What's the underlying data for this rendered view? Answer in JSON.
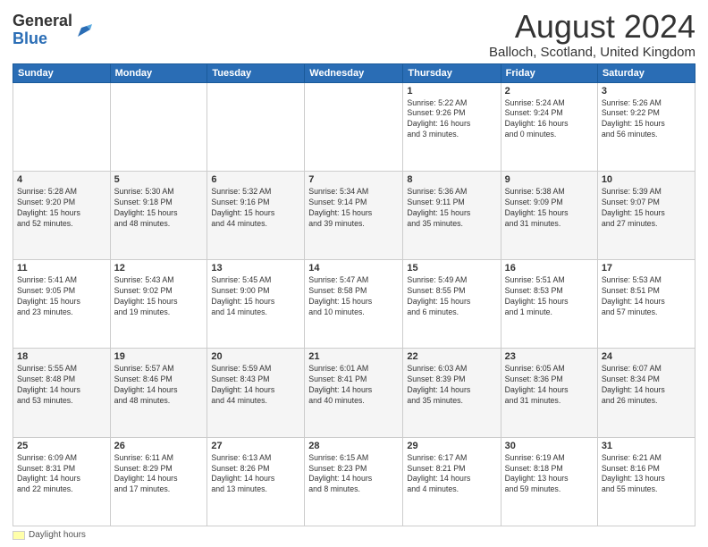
{
  "header": {
    "logo_general": "General",
    "logo_blue": "Blue",
    "title": "August 2024",
    "subtitle": "Balloch, Scotland, United Kingdom"
  },
  "days_of_week": [
    "Sunday",
    "Monday",
    "Tuesday",
    "Wednesday",
    "Thursday",
    "Friday",
    "Saturday"
  ],
  "footer": {
    "swatch_label": "Daylight hours"
  },
  "weeks": [
    [
      {
        "day": "",
        "detail": ""
      },
      {
        "day": "",
        "detail": ""
      },
      {
        "day": "",
        "detail": ""
      },
      {
        "day": "",
        "detail": ""
      },
      {
        "day": "1",
        "detail": "Sunrise: 5:22 AM\nSunset: 9:26 PM\nDaylight: 16 hours\nand 3 minutes."
      },
      {
        "day": "2",
        "detail": "Sunrise: 5:24 AM\nSunset: 9:24 PM\nDaylight: 16 hours\nand 0 minutes."
      },
      {
        "day": "3",
        "detail": "Sunrise: 5:26 AM\nSunset: 9:22 PM\nDaylight: 15 hours\nand 56 minutes."
      }
    ],
    [
      {
        "day": "4",
        "detail": "Sunrise: 5:28 AM\nSunset: 9:20 PM\nDaylight: 15 hours\nand 52 minutes."
      },
      {
        "day": "5",
        "detail": "Sunrise: 5:30 AM\nSunset: 9:18 PM\nDaylight: 15 hours\nand 48 minutes."
      },
      {
        "day": "6",
        "detail": "Sunrise: 5:32 AM\nSunset: 9:16 PM\nDaylight: 15 hours\nand 44 minutes."
      },
      {
        "day": "7",
        "detail": "Sunrise: 5:34 AM\nSunset: 9:14 PM\nDaylight: 15 hours\nand 39 minutes."
      },
      {
        "day": "8",
        "detail": "Sunrise: 5:36 AM\nSunset: 9:11 PM\nDaylight: 15 hours\nand 35 minutes."
      },
      {
        "day": "9",
        "detail": "Sunrise: 5:38 AM\nSunset: 9:09 PM\nDaylight: 15 hours\nand 31 minutes."
      },
      {
        "day": "10",
        "detail": "Sunrise: 5:39 AM\nSunset: 9:07 PM\nDaylight: 15 hours\nand 27 minutes."
      }
    ],
    [
      {
        "day": "11",
        "detail": "Sunrise: 5:41 AM\nSunset: 9:05 PM\nDaylight: 15 hours\nand 23 minutes."
      },
      {
        "day": "12",
        "detail": "Sunrise: 5:43 AM\nSunset: 9:02 PM\nDaylight: 15 hours\nand 19 minutes."
      },
      {
        "day": "13",
        "detail": "Sunrise: 5:45 AM\nSunset: 9:00 PM\nDaylight: 15 hours\nand 14 minutes."
      },
      {
        "day": "14",
        "detail": "Sunrise: 5:47 AM\nSunset: 8:58 PM\nDaylight: 15 hours\nand 10 minutes."
      },
      {
        "day": "15",
        "detail": "Sunrise: 5:49 AM\nSunset: 8:55 PM\nDaylight: 15 hours\nand 6 minutes."
      },
      {
        "day": "16",
        "detail": "Sunrise: 5:51 AM\nSunset: 8:53 PM\nDaylight: 15 hours\nand 1 minute."
      },
      {
        "day": "17",
        "detail": "Sunrise: 5:53 AM\nSunset: 8:51 PM\nDaylight: 14 hours\nand 57 minutes."
      }
    ],
    [
      {
        "day": "18",
        "detail": "Sunrise: 5:55 AM\nSunset: 8:48 PM\nDaylight: 14 hours\nand 53 minutes."
      },
      {
        "day": "19",
        "detail": "Sunrise: 5:57 AM\nSunset: 8:46 PM\nDaylight: 14 hours\nand 48 minutes."
      },
      {
        "day": "20",
        "detail": "Sunrise: 5:59 AM\nSunset: 8:43 PM\nDaylight: 14 hours\nand 44 minutes."
      },
      {
        "day": "21",
        "detail": "Sunrise: 6:01 AM\nSunset: 8:41 PM\nDaylight: 14 hours\nand 40 minutes."
      },
      {
        "day": "22",
        "detail": "Sunrise: 6:03 AM\nSunset: 8:39 PM\nDaylight: 14 hours\nand 35 minutes."
      },
      {
        "day": "23",
        "detail": "Sunrise: 6:05 AM\nSunset: 8:36 PM\nDaylight: 14 hours\nand 31 minutes."
      },
      {
        "day": "24",
        "detail": "Sunrise: 6:07 AM\nSunset: 8:34 PM\nDaylight: 14 hours\nand 26 minutes."
      }
    ],
    [
      {
        "day": "25",
        "detail": "Sunrise: 6:09 AM\nSunset: 8:31 PM\nDaylight: 14 hours\nand 22 minutes."
      },
      {
        "day": "26",
        "detail": "Sunrise: 6:11 AM\nSunset: 8:29 PM\nDaylight: 14 hours\nand 17 minutes."
      },
      {
        "day": "27",
        "detail": "Sunrise: 6:13 AM\nSunset: 8:26 PM\nDaylight: 14 hours\nand 13 minutes."
      },
      {
        "day": "28",
        "detail": "Sunrise: 6:15 AM\nSunset: 8:23 PM\nDaylight: 14 hours\nand 8 minutes."
      },
      {
        "day": "29",
        "detail": "Sunrise: 6:17 AM\nSunset: 8:21 PM\nDaylight: 14 hours\nand 4 minutes."
      },
      {
        "day": "30",
        "detail": "Sunrise: 6:19 AM\nSunset: 8:18 PM\nDaylight: 13 hours\nand 59 minutes."
      },
      {
        "day": "31",
        "detail": "Sunrise: 6:21 AM\nSunset: 8:16 PM\nDaylight: 13 hours\nand 55 minutes."
      }
    ]
  ]
}
